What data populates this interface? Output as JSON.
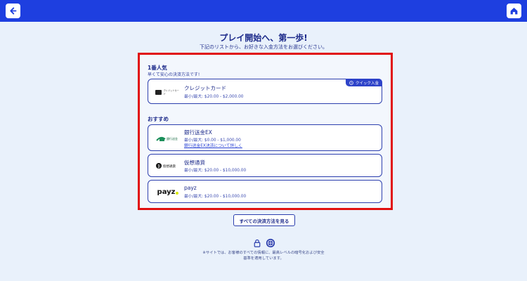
{
  "header": {
    "back_icon": "arrow-left-icon",
    "home_icon": "home-icon"
  },
  "main": {
    "title": "プレイ開始へ、第一歩!",
    "subtitle": "下記のリストから、お好きな入金方法をお選びください。"
  },
  "popular": {
    "title": "1番人気",
    "subtitle": "早くて安心の決済方法です!",
    "methods": [
      {
        "name": "クレジットカード",
        "limits": "最小/最大: $20.00 - $2,000.00",
        "badge": "クイック入金",
        "logo_text": "クレジットカード"
      }
    ]
  },
  "recommended": {
    "title": "おすすめ",
    "methods": [
      {
        "name": "銀行送金EX",
        "limits": "最小/最大: $0.00 - $1,000.00",
        "link": "銀行送金EX決済について詳しく",
        "logo_text": "銀行送金"
      },
      {
        "name": "仮想通貨",
        "limits": "最小/最大: $20.00 - $10,000.00",
        "logo_text": "仮想通貨"
      },
      {
        "name": "payz",
        "limits": "最小/最大: $20.00 - $10,000.00",
        "logo_text": "payz"
      }
    ]
  },
  "actions": {
    "all_methods_label": "すべての決済方法を見る"
  },
  "footer": {
    "note_line1": "※サイトでは、お客様のすべての情報に、最高レベルの暗号化および安全",
    "note_line2": "基準を適用しています。"
  },
  "colors": {
    "accent": "#1e3fe0",
    "highlight_border": "#e10f0f",
    "card_border": "#2c3fae"
  }
}
